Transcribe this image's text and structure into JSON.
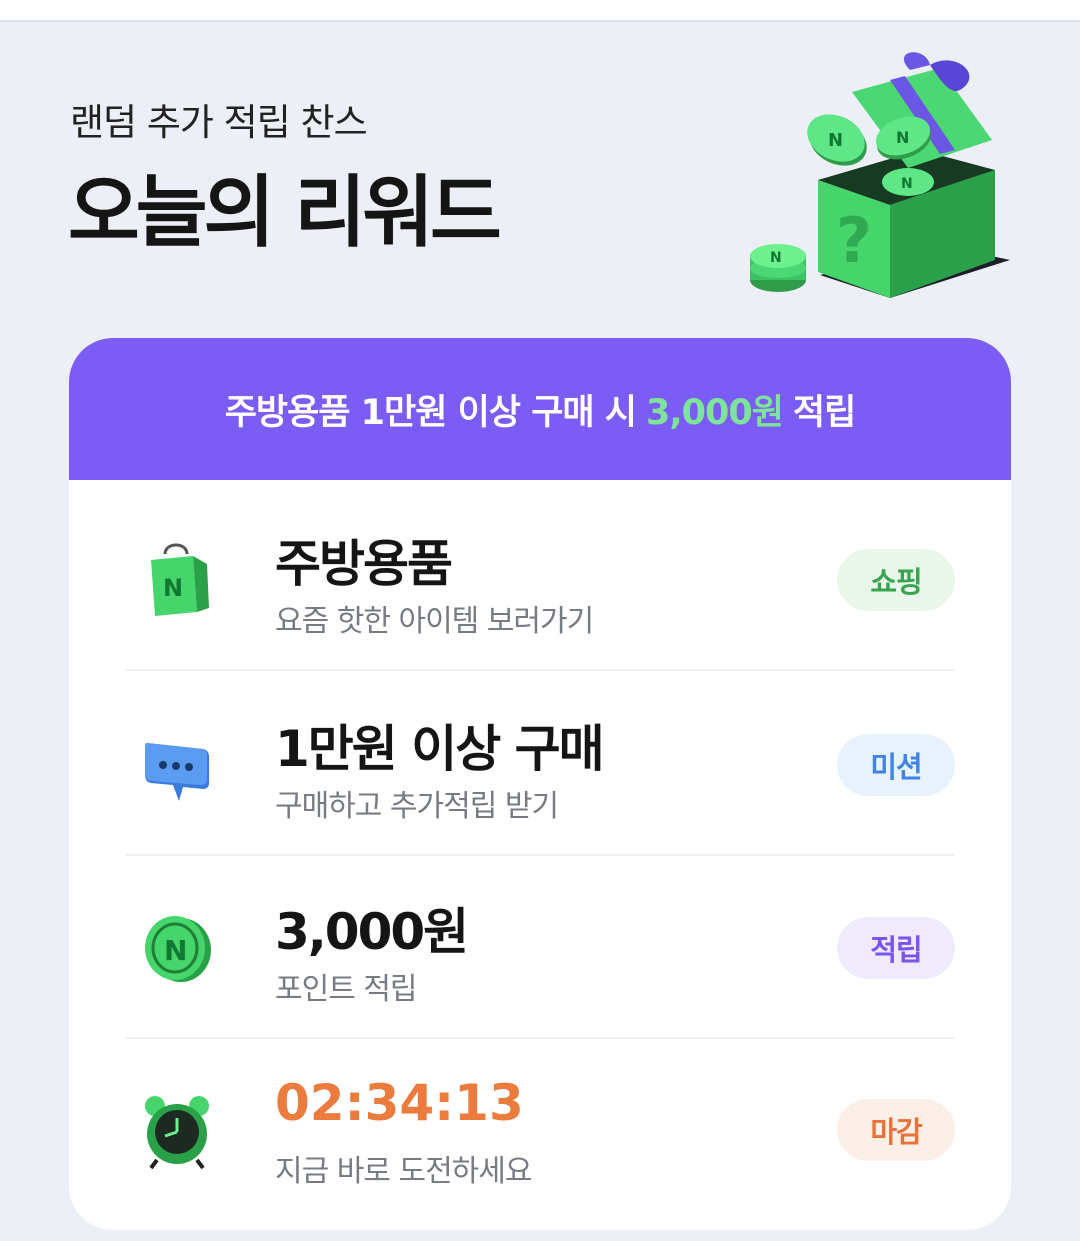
{
  "header": {
    "subtitle": "랜덤 추가 적립 찬스",
    "title": "오늘의 리워드"
  },
  "banner": {
    "prefix": "주방용품 1만원 이상 구매 시",
    "amount": "3,000원",
    "suffix": "적립",
    "amount_color": "#7ee39b",
    "background": "#7b5cf4"
  },
  "rows": [
    {
      "icon": "shopping-bag-icon",
      "title": "주방용품",
      "subtitle": "요즘 핫한 아이템 보러가기",
      "badge": "쇼핑",
      "badge_color": "#3aa34f",
      "badge_bg": "#e9f7ea"
    },
    {
      "icon": "chat-bubble-icon",
      "title": "1만원 이상 구매",
      "subtitle": "구매하고 추가적립 받기",
      "badge": "미션",
      "badge_color": "#3f84e5",
      "badge_bg": "#e7f2fd"
    },
    {
      "icon": "coin-icon",
      "title": "3,000원",
      "subtitle": "포인트 적립",
      "badge": "적립",
      "badge_color": "#7a55ea",
      "badge_bg": "#efebfd"
    },
    {
      "icon": "alarm-clock-icon",
      "title": "02:34:13",
      "subtitle": "지금 바로 도전하세요",
      "badge": "마감",
      "badge_color": "#e8733a",
      "badge_bg": "#fcefe7"
    }
  ]
}
